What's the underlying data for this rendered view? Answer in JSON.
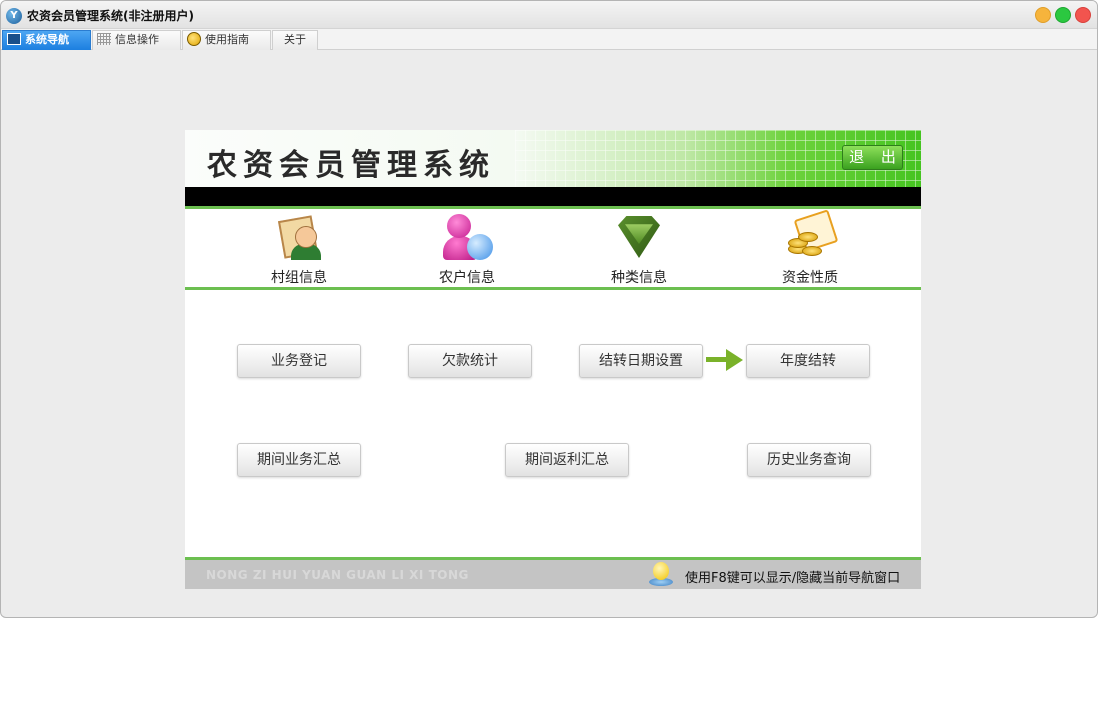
{
  "window": {
    "title": "农资会员管理系统(非注册用户)",
    "app_icon": "app-logo-icon"
  },
  "tabs": [
    {
      "label": "系统导航",
      "icon": "nav-icon",
      "active": true
    },
    {
      "label": "信息操作",
      "icon": "grid-icon",
      "active": false
    },
    {
      "label": "使用指南",
      "icon": "bulb-icon",
      "active": false
    },
    {
      "label": "关于",
      "icon": "",
      "active": false
    }
  ],
  "banner": {
    "title": "农资会员管理系统",
    "exit_label": "退 出"
  },
  "nav_items": [
    {
      "label": "村组信息",
      "icon": "book-person-icon"
    },
    {
      "label": "农户信息",
      "icon": "users-icon"
    },
    {
      "label": "种类信息",
      "icon": "box-icon"
    },
    {
      "label": "资金性质",
      "icon": "coins-card-icon"
    }
  ],
  "functions": {
    "business_register": "业务登记",
    "debt_stats": "欠款统计",
    "carryover_date": "结转日期设置",
    "annual_carryover": "年度结转",
    "period_business_summary": "期间业务汇总",
    "period_rebate_summary": "期间返利汇总",
    "history_query": "历史业务查询"
  },
  "footer": {
    "latin": "NONG ZI HUI YUAN GUAN LI XI TONG",
    "hint": "使用F8键可以显示/隐藏当前导航窗口"
  },
  "colors": {
    "accent_green": "#6cbf50",
    "tab_active": "#1c7fe0"
  }
}
